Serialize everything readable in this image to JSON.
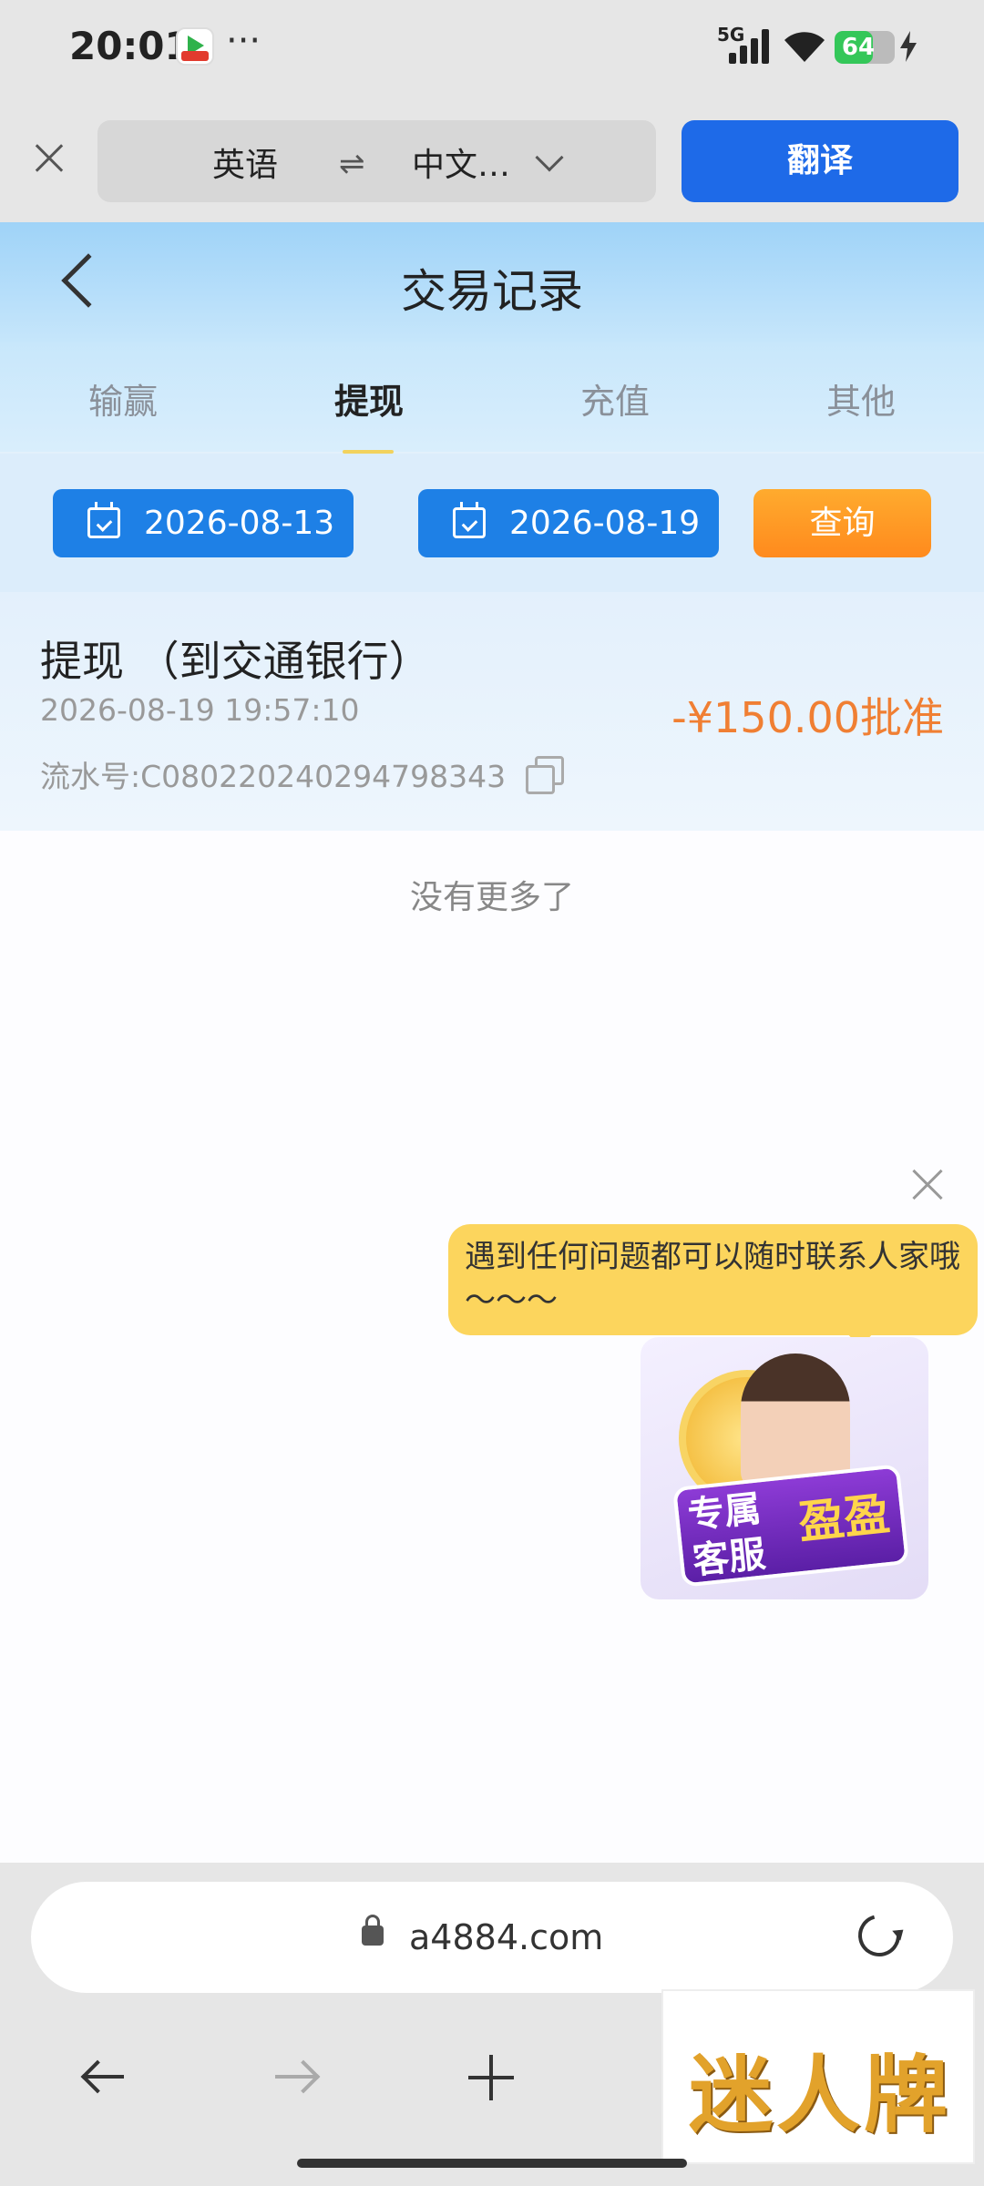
{
  "status_bar": {
    "time": "20:01",
    "dots": "···",
    "network": "5G",
    "battery": "64"
  },
  "translate_bar": {
    "source_lang": "英语",
    "swap": "⇌",
    "target_lang": "中文…",
    "translate_label": "翻译"
  },
  "header": {
    "title": "交易记录"
  },
  "tabs": [
    {
      "label": "输赢",
      "active": false
    },
    {
      "label": "提现",
      "active": true
    },
    {
      "label": "充值",
      "active": false
    },
    {
      "label": "其他",
      "active": false
    }
  ],
  "filter": {
    "start_date": "2026-08-13",
    "end_date": "2026-08-19",
    "query_label": "查询"
  },
  "records": [
    {
      "title": "提现 （到交通银行）",
      "time": "2026-08-19 19:57:10",
      "serial": "流水号:C080220240294798343",
      "amount": "-¥150.00批准"
    }
  ],
  "list_end_text": "没有更多了",
  "support_float": {
    "message": "遇到任何问题都可以随时联系人家哦～～～",
    "tag_line1": "专属",
    "tag_line2": "客服",
    "tag_name": "盈盈"
  },
  "browser": {
    "url": "a4884.com"
  },
  "watermark": {
    "text": "迷人牌"
  },
  "colors": {
    "primary_blue": "#1e6ae8",
    "date_blue": "#1e80e6",
    "query_orange": "#ff9a24",
    "amount_orange": "#f07f33",
    "bubble_yellow": "#fcd55d",
    "battery_green": "#34c759"
  },
  "battery_level": 0.64
}
